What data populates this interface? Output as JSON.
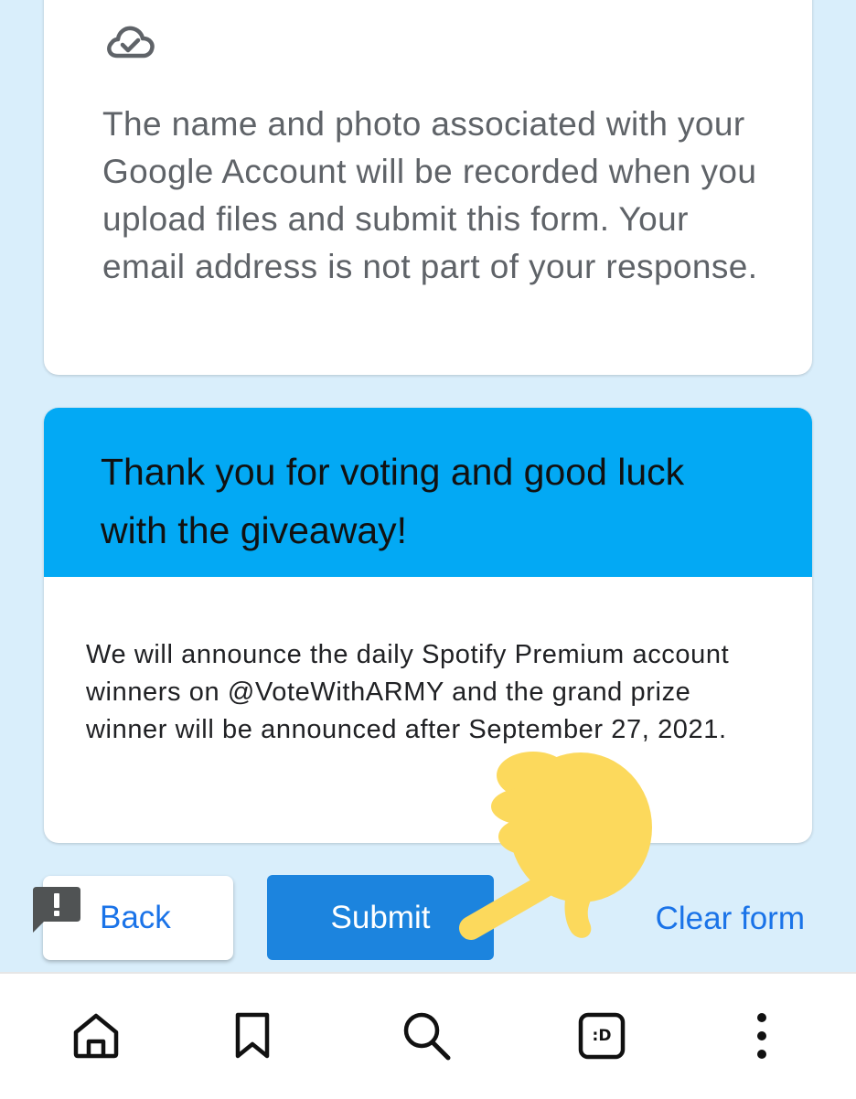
{
  "account_notice": {
    "icon": "cloud-check-icon",
    "text": "The name and photo associated with your Google Account will be recorded when you upload files and submit this form. Your email address is not part of your response."
  },
  "thanks_section": {
    "title": "Thank you for voting and good luck with the giveaway!",
    "body": "We will announce the daily Spotify Premium account winners on @VoteWithARMY and the grand prize winner will be announced after September 27, 2021.",
    "header_color": "#03a9f4"
  },
  "actions": {
    "back_label": "Back",
    "submit_label": "Submit",
    "clear_label": "Clear form",
    "accent_color": "#1a73e8",
    "submit_color": "#1c84de"
  },
  "bottom_nav": {
    "items": [
      {
        "icon": "home-icon"
      },
      {
        "icon": "bookmark-icon"
      },
      {
        "icon": "search-icon"
      },
      {
        "icon": "emoticon-icon",
        "label": ":D"
      },
      {
        "icon": "more-vert-icon"
      }
    ]
  },
  "colors": {
    "background": "#d9eefb",
    "sticker": "#fcd95c"
  }
}
